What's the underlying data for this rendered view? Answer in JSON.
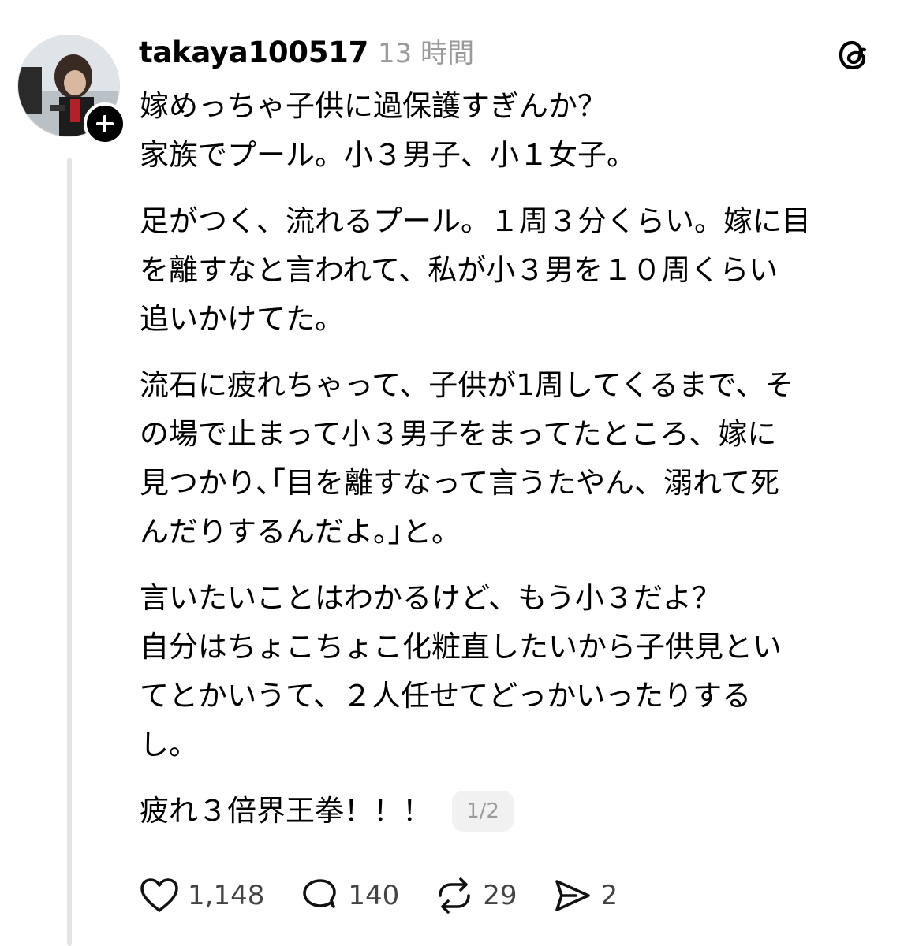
{
  "post": {
    "username": "takaya100517",
    "timestamp": "13 時間",
    "page_indicator": "1/2",
    "paragraphs": [
      [
        "嫁めっちゃ子供に過保護すぎんか？",
        "家族でプール。小３男子、小１女子。"
      ],
      [
        "足がつく、流れるプール。１周３分くらい。嫁に目",
        "を離すなと言われて、私が小３男を１０周くらい",
        "追いかけてた。"
      ],
      [
        "流石に疲れちゃって、子供が1周してくるまで、そ",
        "の場で止まって小３男子をまってたところ、嫁に",
        "見つかり､｢目を離すなって言うたやん、溺れて死",
        "んだりするんだよ。｣と。"
      ],
      [
        "言いたいことはわかるけど、もう小３だよ？",
        "自分はちょこちょこ化粧直したいから子供見とい",
        "てとかいうて、２人任せてどっかいったりする",
        "し。"
      ],
      [
        "疲れ３倍界王拳！！！"
      ]
    ]
  },
  "actions": {
    "likes": "1,148",
    "replies": "140",
    "reposts": "29",
    "shares": "2"
  },
  "icons": {
    "follow": "plus-icon",
    "logo": "threads-logo-icon",
    "like": "heart-icon",
    "reply": "comment-icon",
    "repost": "repost-icon",
    "share": "send-icon"
  },
  "colors": {
    "text": "#000000",
    "muted": "#9a9a9a",
    "counts": "#444444",
    "thread_line": "#e5e5e5"
  }
}
